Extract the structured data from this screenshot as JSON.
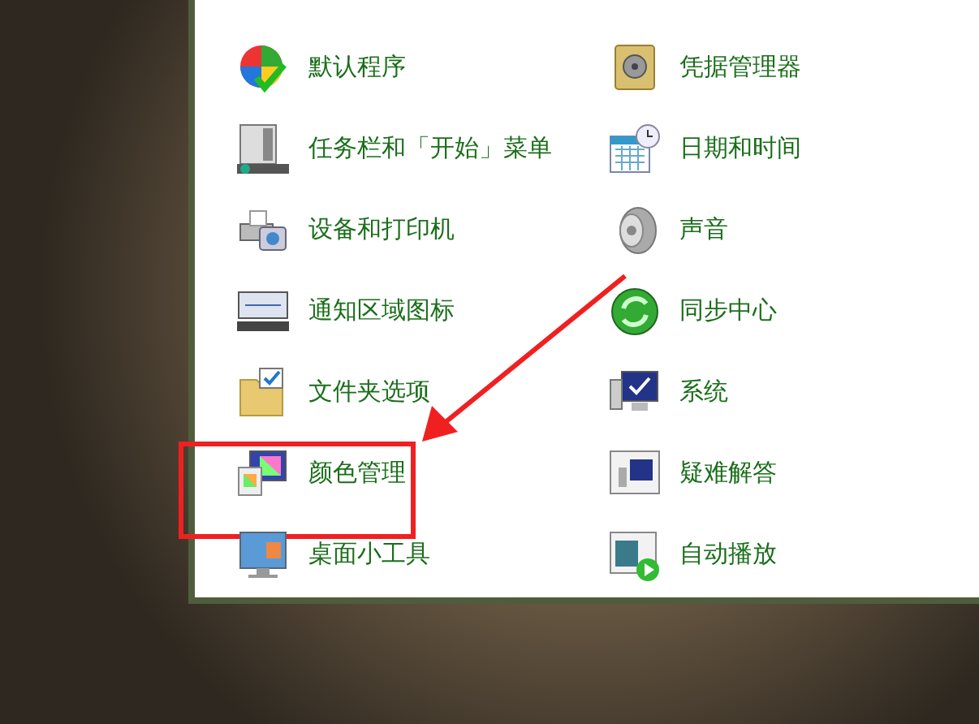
{
  "left_column": [
    {
      "label": "默认程序",
      "highlighted": false
    },
    {
      "label": "任务栏和「开始」菜单",
      "highlighted": false
    },
    {
      "label": "设备和打印机",
      "highlighted": false
    },
    {
      "label": "通知区域图标",
      "highlighted": false
    },
    {
      "label": "文件夹选项",
      "highlighted": false
    },
    {
      "label": "颜色管理",
      "highlighted": true
    },
    {
      "label": "桌面小工具",
      "highlighted": false
    }
  ],
  "right_column": [
    {
      "label": "凭据管理器",
      "highlighted": false
    },
    {
      "label": "日期和时间",
      "highlighted": false
    },
    {
      "label": "声音",
      "highlighted": false
    },
    {
      "label": "同步中心",
      "highlighted": false
    },
    {
      "label": "系统",
      "highlighted": false
    },
    {
      "label": "疑难解答",
      "highlighted": false
    },
    {
      "label": "自动播放",
      "highlighted": false
    }
  ]
}
